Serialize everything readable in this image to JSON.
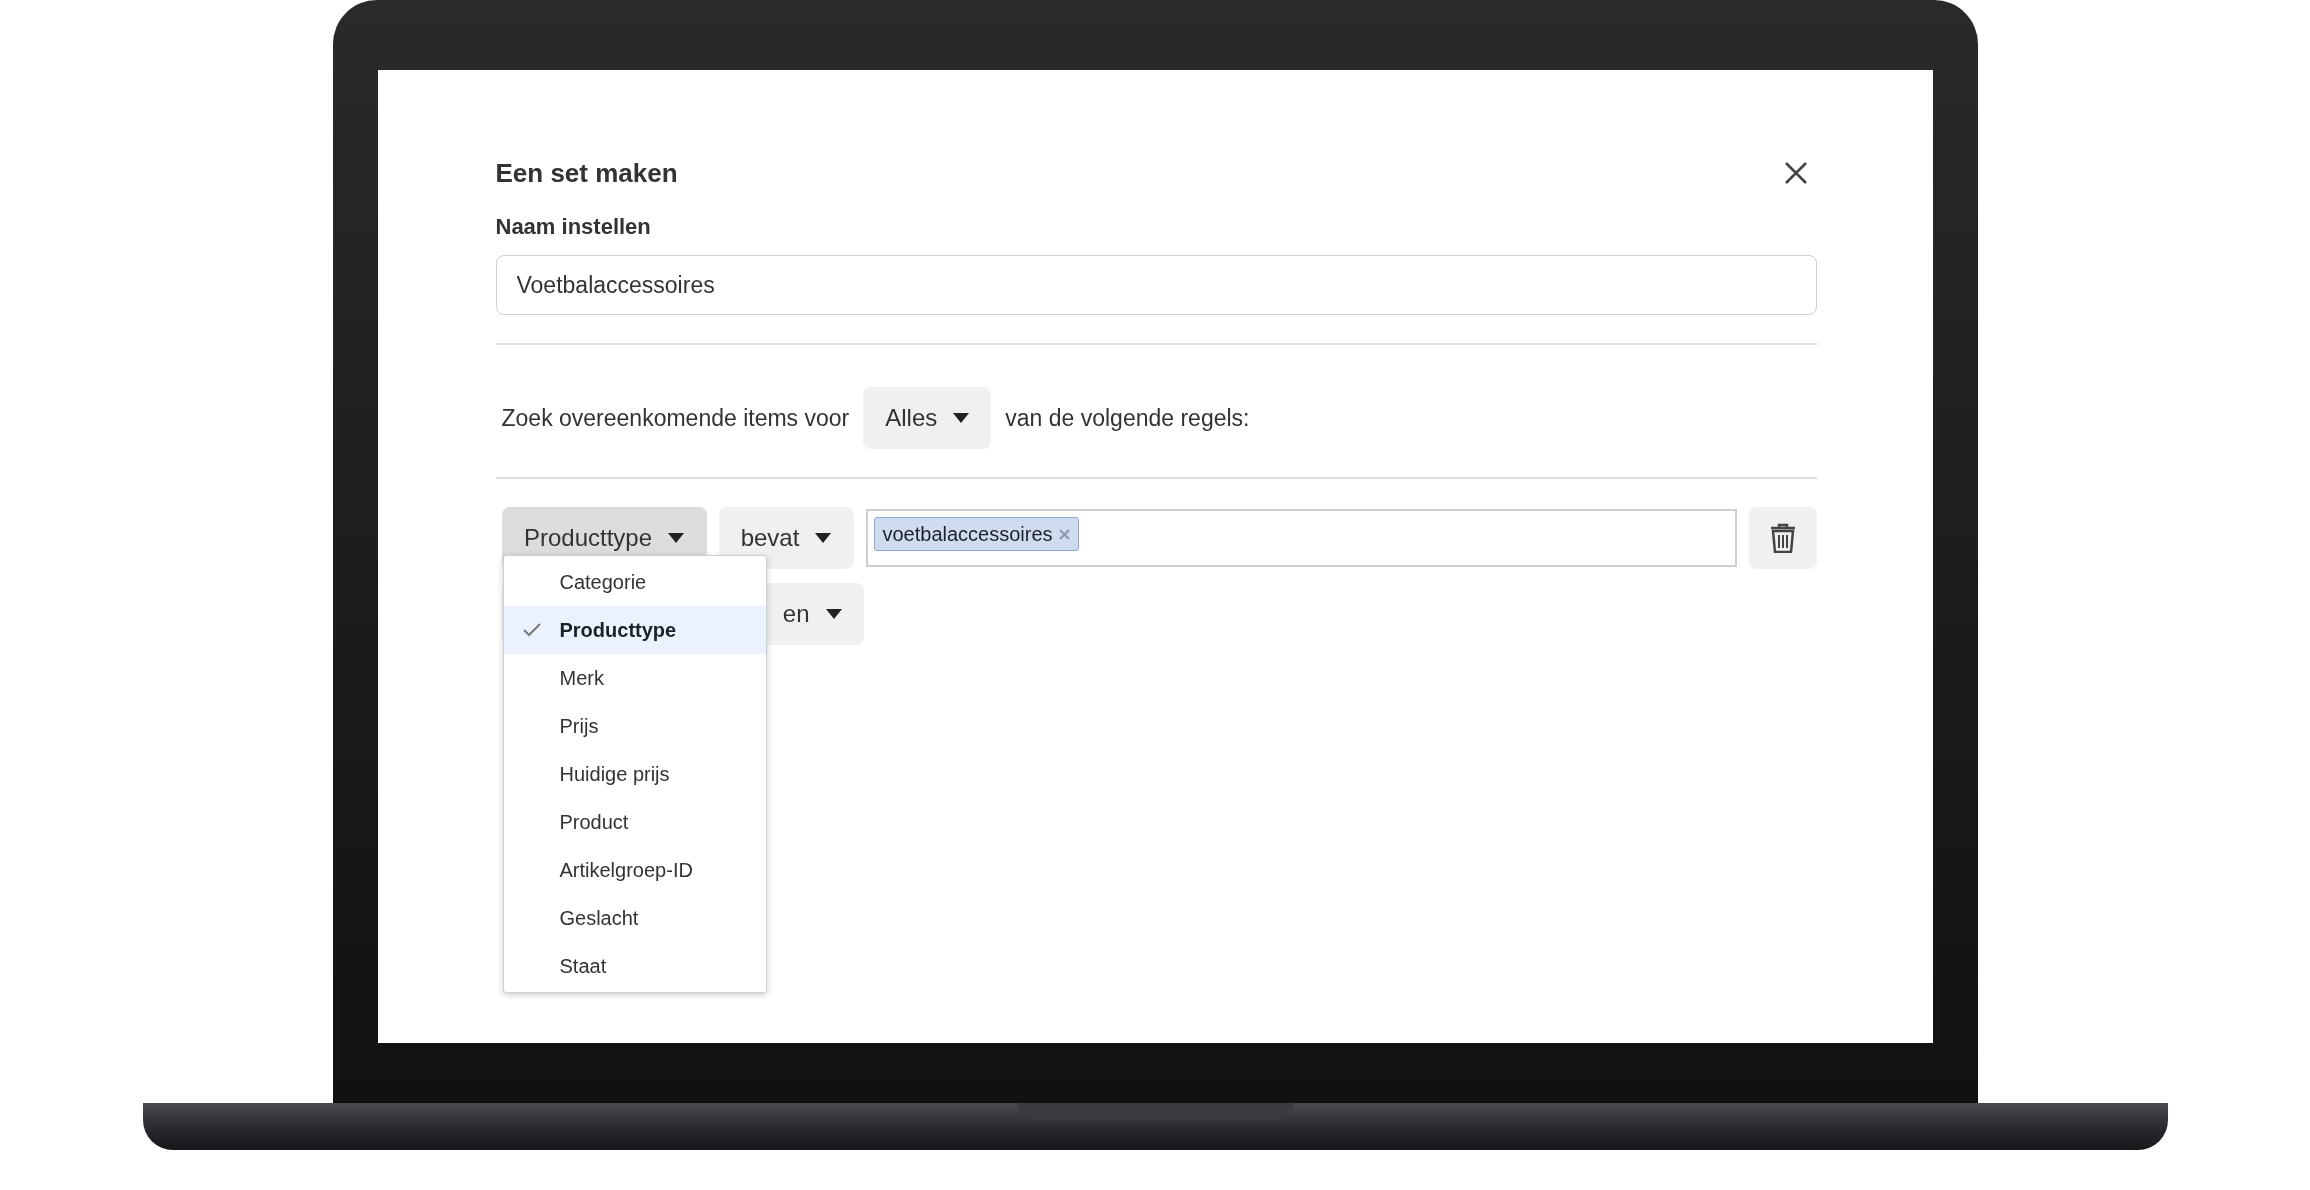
{
  "dialog": {
    "title": "Een set maken",
    "name_label": "Naam instellen",
    "name_value": "Voetbalaccessoires",
    "match_prefix": "Zoek overeenkomende items voor",
    "match_mode": "Alles",
    "match_suffix": "van de volgende regels:",
    "rule": {
      "field": "Producttype",
      "operator": "bevat",
      "tags": [
        "voetbalaccessoires"
      ]
    },
    "second_rule_button": "en",
    "field_menu": [
      {
        "label": "Categorie",
        "selected": false
      },
      {
        "label": "Producttype",
        "selected": true
      },
      {
        "label": "Merk",
        "selected": false
      },
      {
        "label": "Prijs",
        "selected": false
      },
      {
        "label": "Huidige prijs",
        "selected": false
      },
      {
        "label": "Product",
        "selected": false
      },
      {
        "label": "Artikelgroep-ID",
        "selected": false
      },
      {
        "label": "Geslacht",
        "selected": false
      },
      {
        "label": "Staat",
        "selected": false
      }
    ]
  }
}
